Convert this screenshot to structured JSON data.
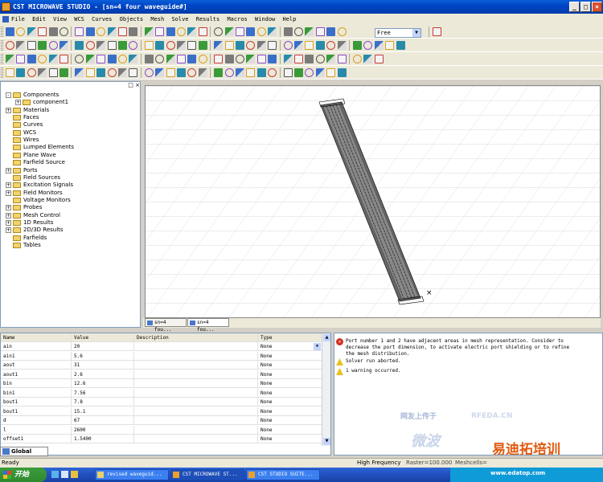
{
  "window": {
    "title": "CST MICROWAVE STUDIO - [sn=4 four waveguide#]"
  },
  "menu": [
    "File",
    "Edit",
    "View",
    "WCS",
    "Curves",
    "Objects",
    "Mesh",
    "Solve",
    "Results",
    "Macros",
    "Window",
    "Help"
  ],
  "toolbar": {
    "mesh_mode_select": "Free"
  },
  "tree": {
    "items": [
      {
        "label": "Components",
        "level": 0,
        "expand": "-"
      },
      {
        "label": "component1",
        "level": 1,
        "expand": "+"
      },
      {
        "label": "Materials",
        "level": 0,
        "expand": "+"
      },
      {
        "label": "Faces",
        "level": 0,
        "expand": ""
      },
      {
        "label": "Curves",
        "level": 0,
        "expand": ""
      },
      {
        "label": "WCS",
        "level": 0,
        "expand": ""
      },
      {
        "label": "Wires",
        "level": 0,
        "expand": ""
      },
      {
        "label": "Lumped Elements",
        "level": 0,
        "expand": ""
      },
      {
        "label": "Plane Wave",
        "level": 0,
        "expand": ""
      },
      {
        "label": "Farfield Source",
        "level": 0,
        "expand": ""
      },
      {
        "label": "Ports",
        "level": 0,
        "expand": "+"
      },
      {
        "label": "Field Sources",
        "level": 0,
        "expand": ""
      },
      {
        "label": "Excitation Signals",
        "level": 0,
        "expand": "+"
      },
      {
        "label": "Field Monitors",
        "level": 0,
        "expand": "+"
      },
      {
        "label": "Voltage Monitors",
        "level": 0,
        "expand": ""
      },
      {
        "label": "Probes",
        "level": 0,
        "expand": "+"
      },
      {
        "label": "Mesh Control",
        "level": 0,
        "expand": "+"
      },
      {
        "label": "1D Results",
        "level": 0,
        "expand": "+"
      },
      {
        "label": "2D/3D Results",
        "level": 0,
        "expand": "+"
      },
      {
        "label": "Farfields",
        "level": 0,
        "expand": ""
      },
      {
        "label": "Tables",
        "level": 0,
        "expand": ""
      }
    ]
  },
  "view_tabs": [
    "sn=4 fou...",
    "sn=4 fou..."
  ],
  "params": {
    "headers": [
      "Name",
      "Value",
      "Description",
      "Type"
    ],
    "rows": [
      [
        "ain",
        "20",
        "",
        "None"
      ],
      [
        "ain1",
        "5.6",
        "",
        "None"
      ],
      [
        "aout",
        "31",
        "",
        "None"
      ],
      [
        "aout1",
        "2.6",
        "",
        "None"
      ],
      [
        "bin",
        "12.6",
        "",
        "None"
      ],
      [
        "bin1",
        "7.56",
        "",
        "None"
      ],
      [
        "bout1",
        "7.8",
        "",
        "None"
      ],
      [
        "bout1",
        "15.1",
        "",
        "None"
      ],
      [
        "d",
        "67",
        "",
        "None"
      ],
      [
        "l",
        "2600",
        "",
        "None"
      ],
      [
        "offset1",
        "1.5400",
        "",
        "None"
      ]
    ],
    "tab": "Global"
  },
  "messages": [
    {
      "type": "error",
      "text": "Port number 1 and 2 have adjacent areas in mesh representation. Consider to decrease the port dimension, to activate electric port shielding or to refine the mesh distribution."
    },
    {
      "type": "warning",
      "text": "Solver run aborted."
    },
    {
      "type": "warning",
      "text": "1 warning occurred."
    }
  ],
  "status": {
    "left": "Ready",
    "freq": "High Frequency",
    "raster": "Raster=100.000",
    "mesh": "Meshcells="
  },
  "taskbar": {
    "start": "开始",
    "tasks": [
      "revised waveguid...",
      "CST MICROWAVE ST...",
      "CST STUDIO SUITE..."
    ]
  },
  "watermarks": {
    "cn1": "网友上传于",
    "cn2": "微波",
    "logo": "RFEDA.CN",
    "cn3": "易迪拓培训",
    "url": "www.edatop.com"
  },
  "colors": {
    "accent": "#0046c7",
    "error": "#d03020",
    "warning": "#e8c020"
  }
}
